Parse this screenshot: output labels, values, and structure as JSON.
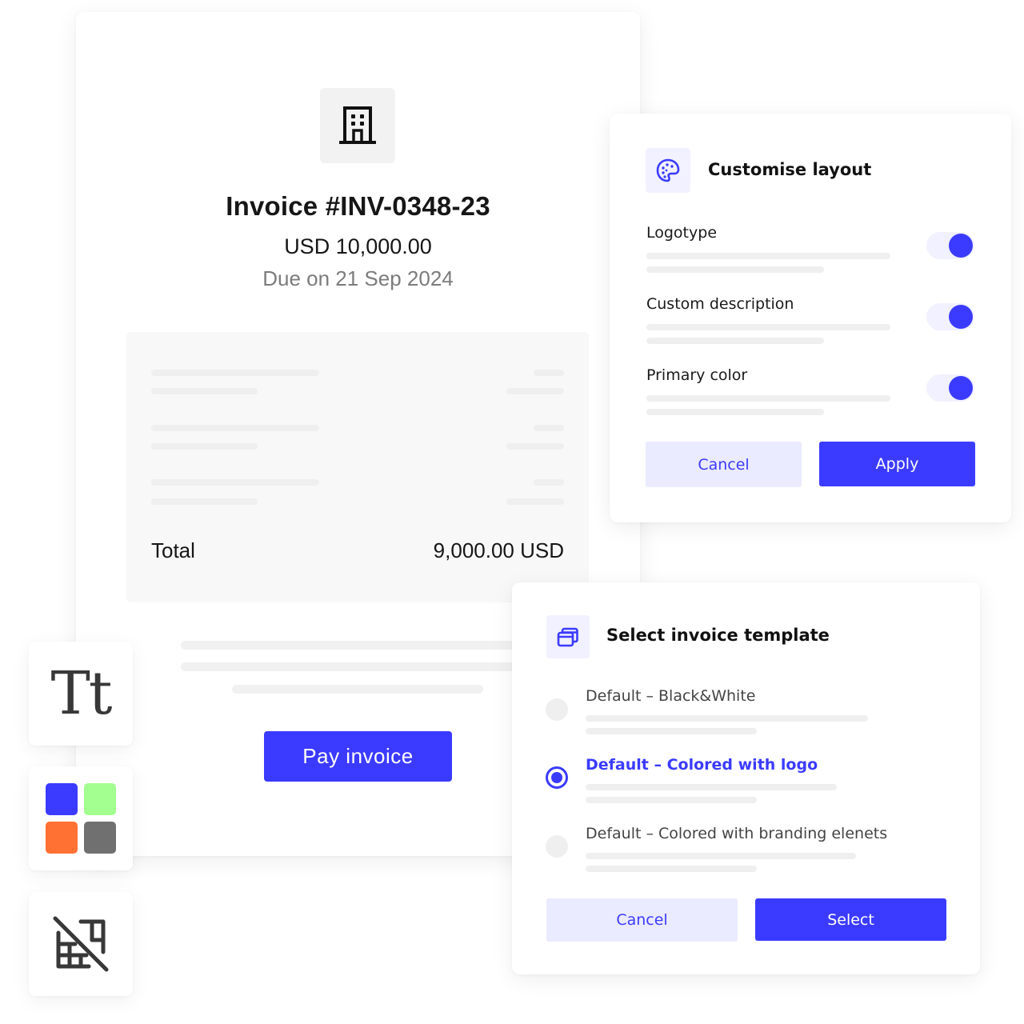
{
  "invoice": {
    "logo_icon": "building-icon",
    "title": "Invoice #INV-0348-23",
    "amount": "USD 10,000.00",
    "due": "Due on 21 Sep 2024",
    "total_label": "Total",
    "total_value": "9,000.00 USD",
    "pay_button": "Pay invoice"
  },
  "customise_layout": {
    "icon": "palette-icon",
    "title": "Customise layout",
    "options": [
      {
        "label": "Logotype",
        "enabled": true
      },
      {
        "label": "Custom description",
        "enabled": true
      },
      {
        "label": "Primary color",
        "enabled": true
      }
    ],
    "cancel_button": "Cancel",
    "apply_button": "Apply"
  },
  "template_selector": {
    "icon": "template-stack-icon",
    "title": "Select invoice template",
    "options": [
      {
        "label": "Default – Black&White",
        "selected": false
      },
      {
        "label": "Default – Colored with logo",
        "selected": true
      },
      {
        "label": "Default – Colored with branding elenets",
        "selected": false
      }
    ],
    "cancel_button": "Cancel",
    "select_button": "Select"
  },
  "tools": {
    "typography_glyph": "Tt",
    "swatches": [
      "#3b3bff",
      "#a3ff8f",
      "#ff7033",
      "#707070"
    ],
    "grid_off_icon": "grid-off-icon"
  },
  "colors": {
    "accent": "#3b3bff",
    "accent_light": "#ebebff",
    "skeleton": "#efefef",
    "muted_text": "#7c7c7c"
  }
}
